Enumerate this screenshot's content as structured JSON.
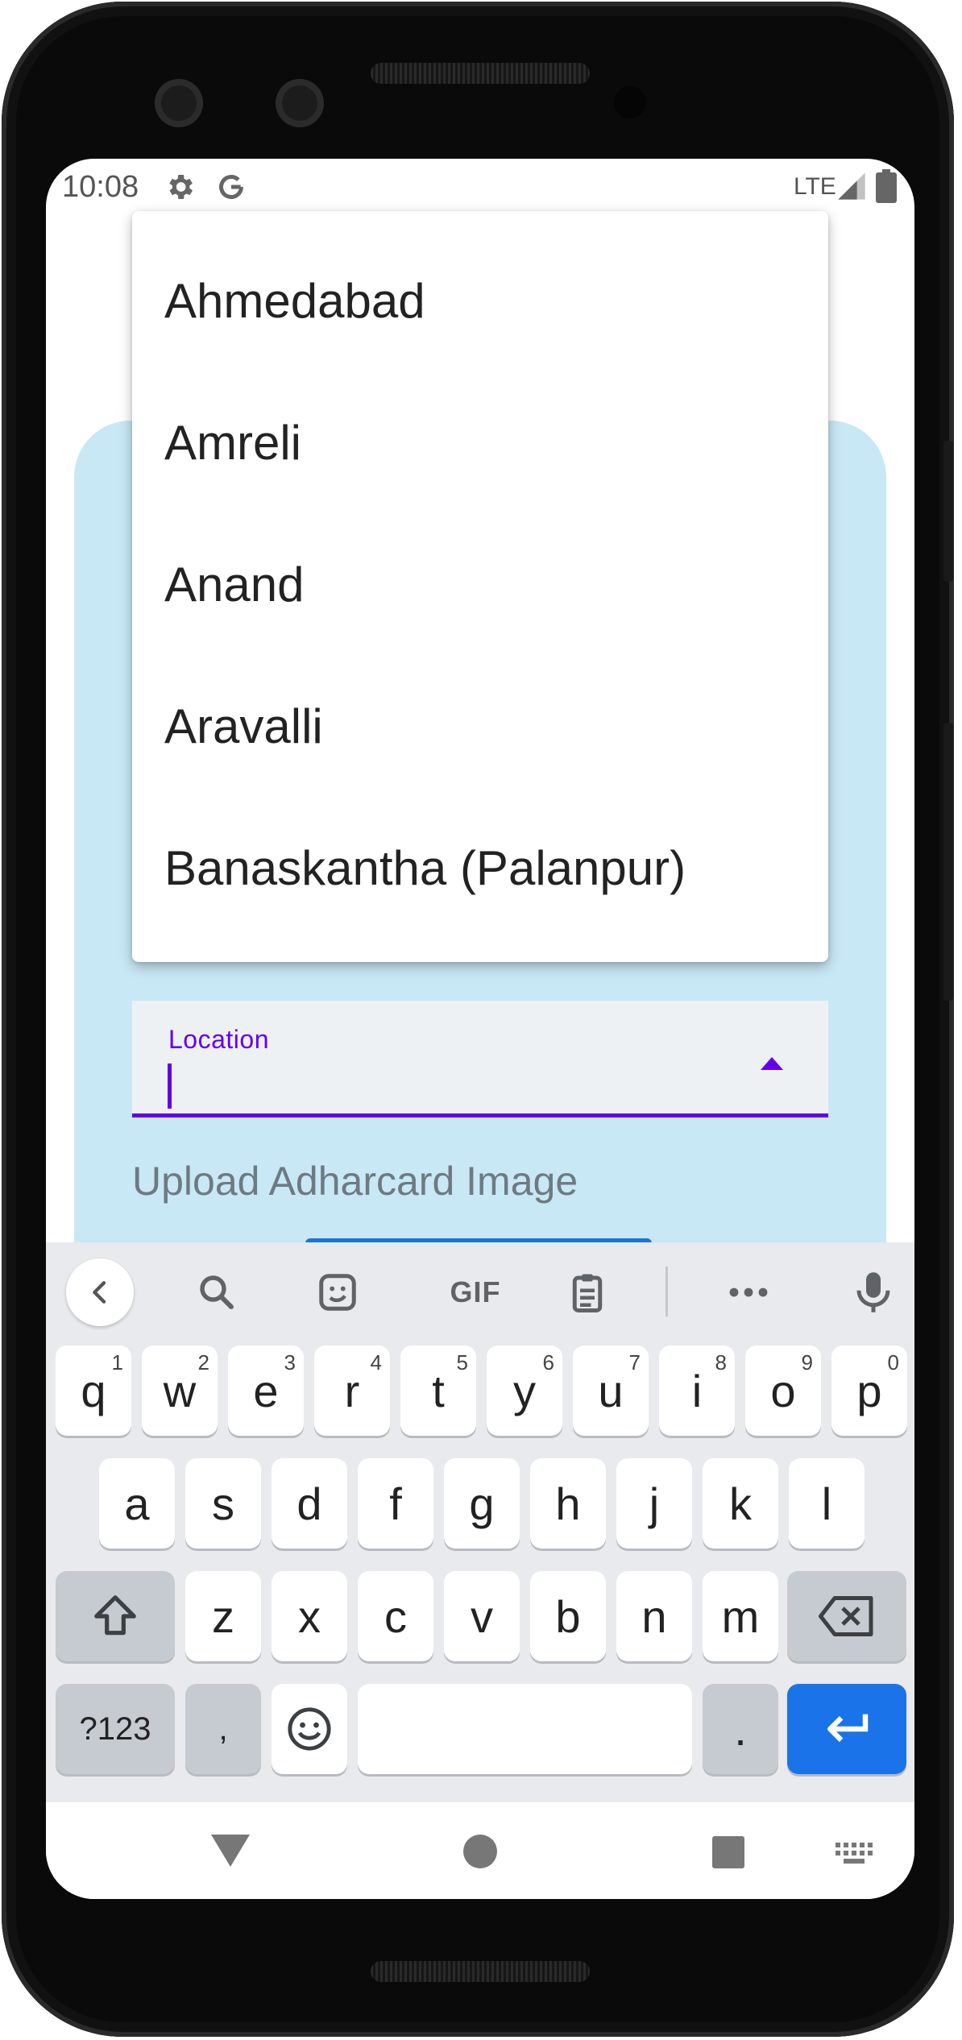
{
  "status_bar": {
    "time": "10:08",
    "network": "LTE",
    "icons": [
      "gear-icon",
      "google-g-icon",
      "signal-icon",
      "battery-icon"
    ]
  },
  "dropdown": {
    "items": [
      "Ahmedabad",
      "Amreli",
      "Anand",
      "Aravalli",
      "Banaskantha (Palanpur)"
    ]
  },
  "form": {
    "location_label": "Location",
    "location_value": "",
    "upload_label": "Upload Adharcard Image"
  },
  "keyboard": {
    "toolbar_icons": [
      "back-chevron-icon",
      "search-icon",
      "sticker-icon",
      "gif-icon",
      "clipboard-icon",
      "more-icon",
      "mic-icon"
    ],
    "gif_label": "GIF",
    "row1": [
      {
        "key": "q",
        "hint": "1"
      },
      {
        "key": "w",
        "hint": "2"
      },
      {
        "key": "e",
        "hint": "3"
      },
      {
        "key": "r",
        "hint": "4"
      },
      {
        "key": "t",
        "hint": "5"
      },
      {
        "key": "y",
        "hint": "6"
      },
      {
        "key": "u",
        "hint": "7"
      },
      {
        "key": "i",
        "hint": "8"
      },
      {
        "key": "o",
        "hint": "9"
      },
      {
        "key": "p",
        "hint": "0"
      }
    ],
    "row2": [
      "a",
      "s",
      "d",
      "f",
      "g",
      "h",
      "j",
      "k",
      "l"
    ],
    "row3": [
      "z",
      "x",
      "c",
      "v",
      "b",
      "n",
      "m"
    ],
    "symbols_label": "?123",
    "comma_label": ",",
    "period_label": ".",
    "special_keys": [
      "shift-icon",
      "backspace-icon",
      "emoji-icon",
      "space-bar",
      "enter-icon"
    ]
  },
  "nav_bar": {
    "icons": [
      "nav-back-icon",
      "nav-home-icon",
      "nav-recents-icon",
      "keyboard-switch-icon"
    ]
  },
  "colors": {
    "accent": "#6200ee",
    "card_background": "#c8e8f6",
    "enter_key": "#1a73e8"
  }
}
